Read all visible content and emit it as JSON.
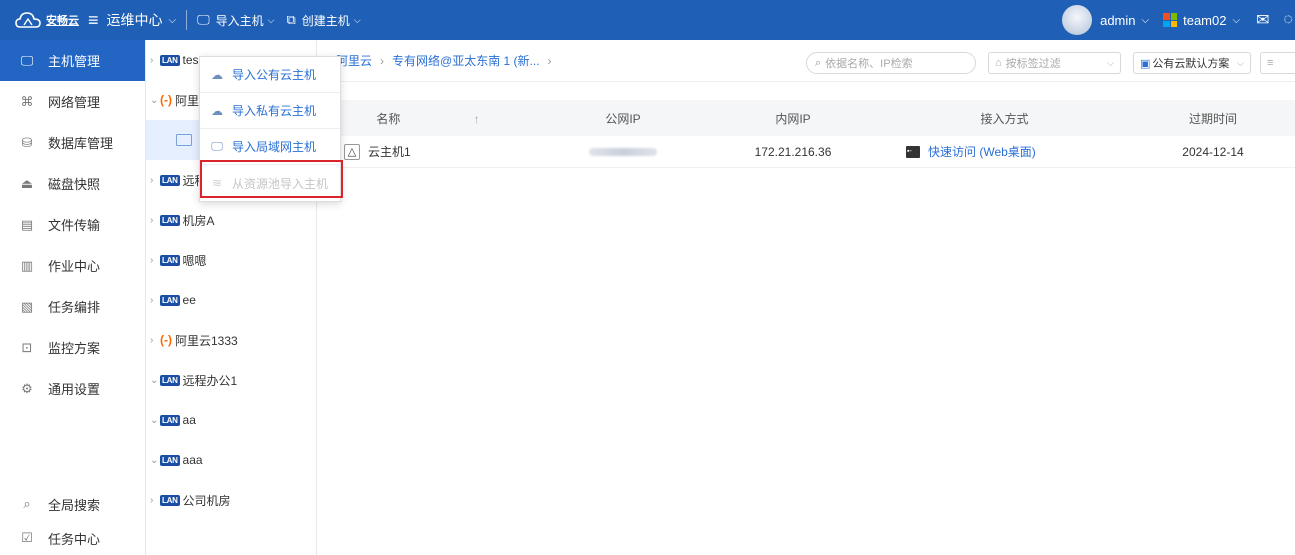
{
  "topbar": {
    "logo_text": "安畅云",
    "ops_center": "运维中心",
    "import_host": "导入主机",
    "create_host": "创建主机",
    "user": "admin",
    "team": "team02"
  },
  "sidebar": {
    "items": [
      {
        "label": "主机管理",
        "icon": "monitor-icon"
      },
      {
        "label": "网络管理",
        "icon": "network-icon"
      },
      {
        "label": "数据库管理",
        "icon": "database-icon"
      },
      {
        "label": "磁盘快照",
        "icon": "disk-icon"
      },
      {
        "label": "文件传输",
        "icon": "file-transfer-icon"
      },
      {
        "label": "作业中心",
        "icon": "job-icon"
      },
      {
        "label": "任务编排",
        "icon": "task-icon"
      },
      {
        "label": "监控方案",
        "icon": "monitor-chart-icon"
      },
      {
        "label": "通用设置",
        "icon": "gear-icon"
      }
    ],
    "bottom": [
      {
        "label": "全局搜索",
        "icon": "search-icon"
      },
      {
        "label": "任务中心",
        "icon": "task-center-icon"
      }
    ]
  },
  "tree": {
    "items": [
      {
        "label": "tes",
        "type": "lan"
      },
      {
        "label": "阿里",
        "type": "ali"
      },
      {
        "label": "",
        "type": "selected"
      },
      {
        "label": "远程",
        "type": "lan"
      },
      {
        "label": "机房A",
        "type": "lan"
      },
      {
        "label": "嗯嗯",
        "type": "lan"
      },
      {
        "label": "ee",
        "type": "lan"
      },
      {
        "label": "阿里云1333",
        "type": "ali"
      },
      {
        "label": "远程办公1",
        "type": "lan"
      },
      {
        "label": "aa",
        "type": "lan"
      },
      {
        "label": "aaa",
        "type": "lan"
      },
      {
        "label": "公司机房",
        "type": "lan"
      }
    ]
  },
  "dropdown": {
    "items": [
      {
        "label": "导入公有云主机",
        "disabled": false
      },
      {
        "label": "导入私有云主机",
        "disabled": false
      },
      {
        "label": "导入局域网主机",
        "disabled": false
      },
      {
        "label": "从资源池导入主机",
        "disabled": true
      }
    ]
  },
  "toolbar": {
    "breadcrumb_1": "阿里云",
    "breadcrumb_2": "专有网络@亚太东南 1 (新...",
    "search_placeholder": "依据名称、IP检索",
    "tag_filter": "按标签过滤",
    "scheme": "公有云默认方案"
  },
  "table": {
    "headers": {
      "name": "名称",
      "public_ip": "公网IP",
      "private_ip": "内网IP",
      "access": "接入方式",
      "expiry": "过期时间"
    },
    "rows": [
      {
        "name": "云主机1",
        "private_ip": "172.21.216.36",
        "access": "快速访问 (Web桌面)",
        "expiry": "2024-12-14"
      }
    ]
  },
  "colors": {
    "topbar": "#1f5fb5",
    "accent": "#2265c2",
    "highlight": "#d9252b"
  }
}
